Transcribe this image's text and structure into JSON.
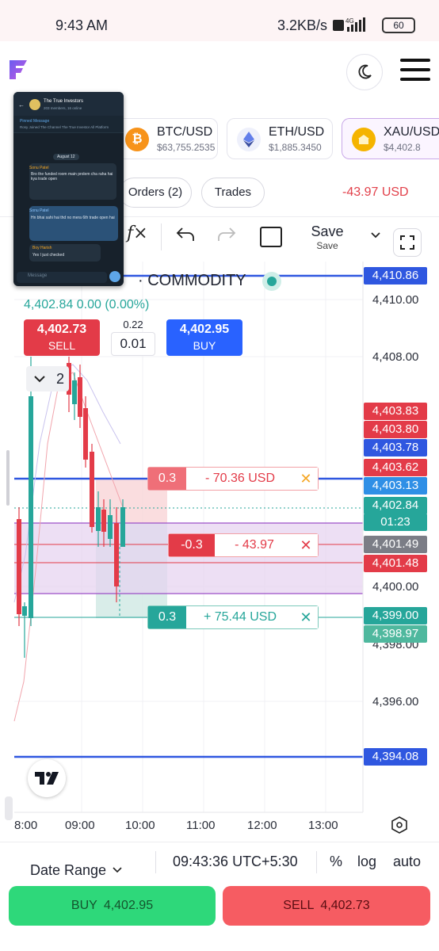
{
  "status_bar": {
    "time": "9:43 AM",
    "net_speed": "3.2KB/s",
    "network": "4G",
    "battery": "60"
  },
  "header": {
    "logo_icon": "f-logo-icon",
    "theme_icon": "moon-icon",
    "menu_icon": "hamburger-icon"
  },
  "symbols": [
    {
      "name": "BTC/USD",
      "price": "$63,755.2535",
      "icon": "bitcoin-icon",
      "color": "#f7931a"
    },
    {
      "name": "ETH/USD",
      "price": "$1,885.3450",
      "icon": "ethereum-icon",
      "color": "#627eea"
    },
    {
      "name": "XAU/USD",
      "price": "$4,402.8",
      "icon": "gold-icon",
      "color": "#f5b400"
    }
  ],
  "tabs": {
    "orders": "Orders (2)",
    "trades": "Trades",
    "pnl": "-43.97 USD"
  },
  "toolbar": {
    "fx_label": "f×",
    "save_label": "Save",
    "save_sub": "Save"
  },
  "chart": {
    "market_label": "· COMMODITY",
    "ohlc_change": "4,402.84  0.00 (0.00%)",
    "sell_price": "4,402.73",
    "sell_label": "SELL",
    "buy_price": "4,402.95",
    "buy_label": "BUY",
    "lot_step": "0.22",
    "lot_qty": "0.01",
    "interval": "2",
    "price_axis": [
      "4,410.00",
      "4,408.00",
      "4,400.00",
      "4,398.00",
      "4,396.00"
    ],
    "time_axis": [
      "8:00",
      "09:00",
      "10:00",
      "11:00",
      "12:00",
      "13:00"
    ],
    "price_tags": [
      {
        "text": "4,410.86",
        "color": "#2f57e0"
      },
      {
        "text": "4,403.83",
        "color": "#e33b48"
      },
      {
        "text": "4,403.80",
        "color": "#e33b48"
      },
      {
        "text": "4,403.78",
        "color": "#2f57e0"
      },
      {
        "text": "4,403.62",
        "color": "#e33b48"
      },
      {
        "text": "4,403.13",
        "color": "#2f8fe6"
      },
      {
        "text": "4,402.84",
        "color": "#26a69a"
      },
      {
        "text": "01:23",
        "color": "#26a69a"
      },
      {
        "text": "4,401.49",
        "color": "#7b7d86"
      },
      {
        "text": "4,401.48",
        "color": "#e33b48"
      },
      {
        "text": "4,399.00",
        "color": "#26a69a"
      },
      {
        "text": "4,398.97",
        "color": "#4fb89e"
      },
      {
        "text": "4,394.08",
        "color": "#2f57e0"
      }
    ],
    "orders": [
      {
        "qty": "0.3",
        "value": "- 70.36 USD",
        "kind": "sl"
      },
      {
        "qty": "-0.3",
        "value": "- 43.97",
        "kind": "position"
      },
      {
        "qty": "0.3",
        "value": "+ 75.44 USD",
        "kind": "tp"
      }
    ]
  },
  "bottom_bar": {
    "date_range": "Date Range",
    "clock": "09:43:36 UTC+5:30",
    "percent": "%",
    "log": "log",
    "auto": "auto"
  },
  "actions": {
    "buy_label": "BUY",
    "buy_price": "4,402.95",
    "sell_label": "SELL",
    "sell_price": "4,402.73"
  },
  "chat_overlay": {
    "title": "The True Investors",
    "subtitle": "203 members, 16 online",
    "pinned_label": "Pinned Message",
    "pinned_text": "Rosy Joined The Channel The True Investor All Platform",
    "date_chip": "August 12",
    "msg1_author": "Sonu Patel",
    "msg1_text": "Bro the funded room main prolem cha raha hai kya trade open",
    "msg2_author": "Sonu Patel",
    "msg2_text": "Hn bhai sahi hai  thd no mera 6th trade open hai",
    "msg3_author": "Boy Harish",
    "msg3_text": "Yes I just checked",
    "input_placeholder": "Message"
  }
}
